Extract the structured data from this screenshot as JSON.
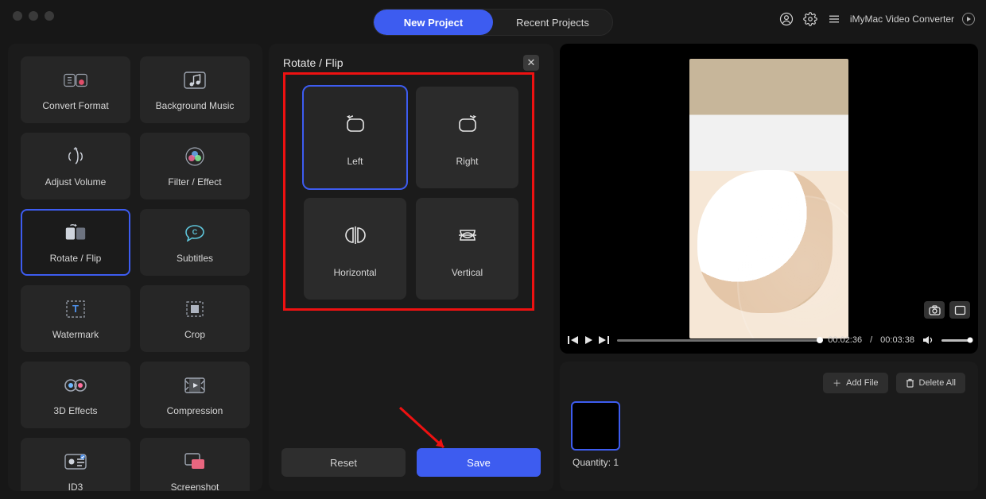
{
  "header": {
    "tabs": {
      "new_project": "New Project",
      "recent_projects": "Recent Projects"
    },
    "app_name": "iMyMac Video Converter"
  },
  "sidebar": {
    "tools": [
      {
        "label": "Convert Format"
      },
      {
        "label": "Background Music"
      },
      {
        "label": "Adjust Volume"
      },
      {
        "label": "Filter / Effect"
      },
      {
        "label": "Rotate / Flip"
      },
      {
        "label": "Subtitles"
      },
      {
        "label": "Watermark"
      },
      {
        "label": "Crop"
      },
      {
        "label": "3D Effects"
      },
      {
        "label": "Compression"
      },
      {
        "label": "ID3"
      },
      {
        "label": "Screenshot"
      }
    ]
  },
  "editor": {
    "title": "Rotate / Flip",
    "tiles": {
      "left": "Left",
      "right": "Right",
      "horizontal": "Horizontal",
      "vertical": "Vertical"
    },
    "reset": "Reset",
    "save": "Save"
  },
  "player": {
    "current_time": "00:02:36",
    "total_time": "00:03:38"
  },
  "files": {
    "add_file": "Add File",
    "delete_all": "Delete All",
    "quantity_label": "Quantity:",
    "quantity_value": "1"
  }
}
